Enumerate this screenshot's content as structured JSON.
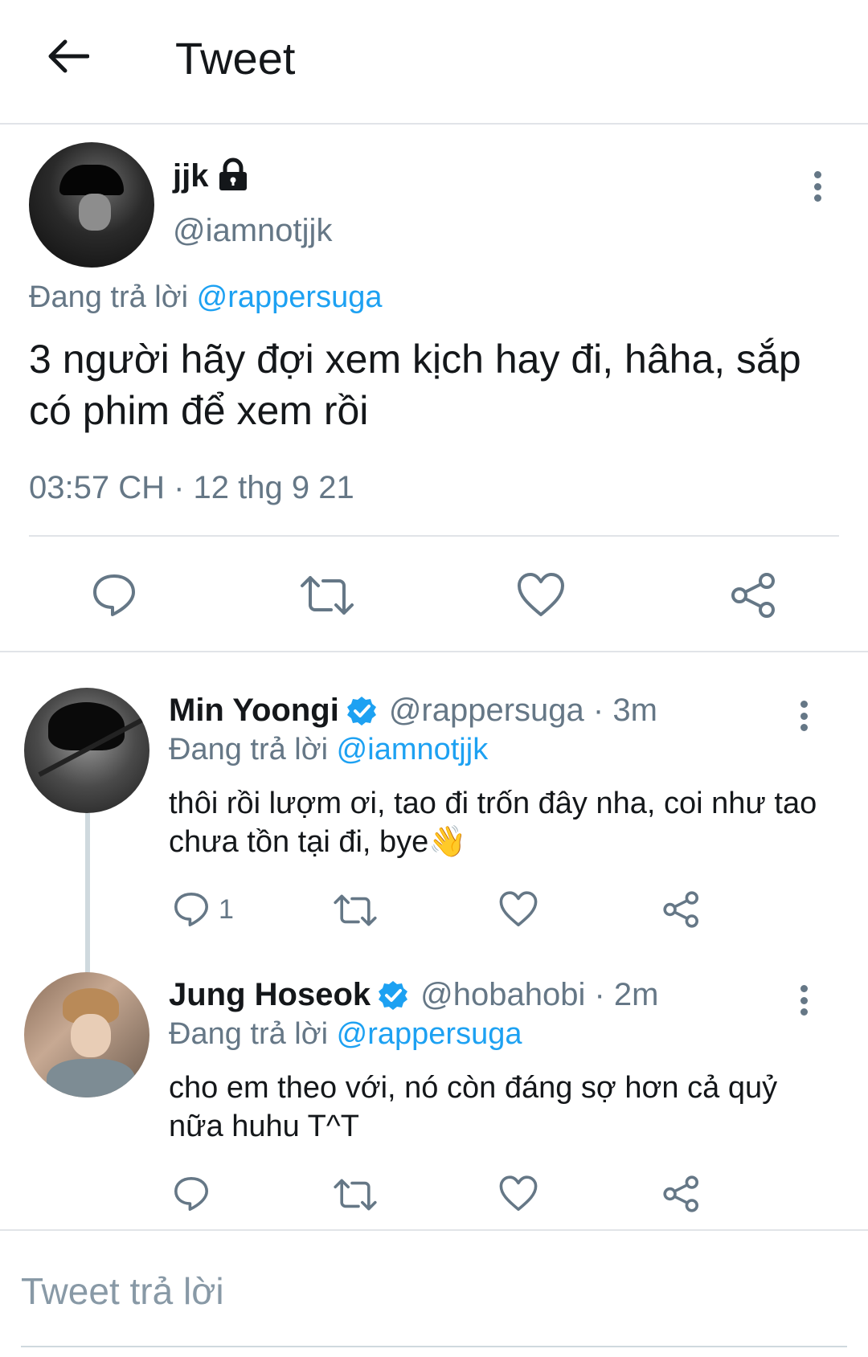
{
  "header": {
    "title": "Tweet",
    "back_icon": "arrow-left-icon"
  },
  "main_tweet": {
    "display_name": "jjk",
    "handle": "@iamnotjjk",
    "protected_icon": "lock-icon",
    "reply_prefix": "Đang trả lời",
    "reply_to": "@rappersuga",
    "text": "3 người hãy đợi xem kịch hay đi, hâha, sắp có phim để xem rồi",
    "timestamp": "03:57 CH · 12 thg 9 21",
    "actions": [
      "reply-icon",
      "retweet-icon",
      "like-icon",
      "share-icon"
    ]
  },
  "replies": [
    {
      "display_name": "Min Yoongi",
      "verified": true,
      "handle_time": "@rappersuga · 3m",
      "reply_prefix": "Đang trả lời",
      "reply_to": "@iamnotjjk",
      "text": "thôi rồi lượm ơi, tao đi trốn đây nha, coi như tao chưa tồn tại đi, bye👋",
      "reply_count": "1"
    },
    {
      "display_name": "Jung Hoseok",
      "verified": true,
      "handle_time": "@hobahobi · 2m",
      "reply_prefix": "Đang trả lời",
      "reply_to": "@rappersuga",
      "text": "cho em theo với, nó còn đáng sợ hơn cả quỷ nữa huhu T^T",
      "reply_count": ""
    }
  ],
  "compose": {
    "placeholder": "Tweet trả lời"
  },
  "colors": {
    "accent": "#1da1f2",
    "muted": "#657786",
    "text": "#14171a",
    "divider": "#e1e4e8"
  }
}
